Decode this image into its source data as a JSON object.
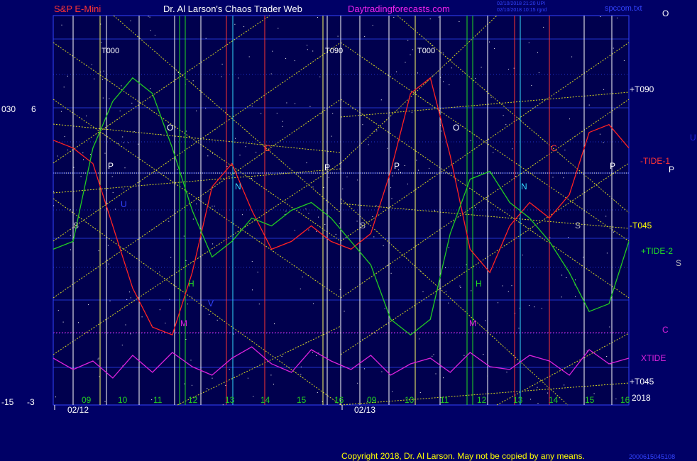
{
  "header": {
    "instrument": "S&P E-Mini",
    "title": "Dr. Al Larson's Chaos Trader Web",
    "site": "Daytradingforecasts.com",
    "stamp1": "02/10/2018 21:20 UPI",
    "stamp2": "02/10/2018 10:15 rgnd",
    "file": "spccom.txt",
    "corner_letter": "O"
  },
  "footer": {
    "copyright": "Copyright 2018, Dr. Al Larson. May not be copied by any means.",
    "code": "2000615045108"
  },
  "left_scale": {
    "row_top": [
      "030",
      "6"
    ],
    "row_bottom": [
      "-15",
      "-3"
    ]
  },
  "right_labels": [
    {
      "text": "+T090",
      "color": "#ffffff"
    },
    {
      "text": "-TIDE-1",
      "color": "#ff3333"
    },
    {
      "text": "P",
      "color": "#ffffff"
    },
    {
      "text": "U",
      "color": "#2222dd"
    },
    {
      "text": "-T045",
      "color": "#ffff00"
    },
    {
      "text": "+TIDE-2",
      "color": "#22dd22"
    },
    {
      "text": "S",
      "color": "#bbbbbb"
    },
    {
      "text": "C",
      "color": "#dd22dd"
    },
    {
      "text": "XTIDE",
      "color": "#dd22dd"
    },
    {
      "text": "+T045",
      "color": "#ffffff"
    },
    {
      "text": "2018",
      "color": "#ffffff"
    }
  ],
  "chart_data": {
    "type": "line",
    "x_axis": {
      "hour_labels": [
        "09",
        "10",
        "11",
        "12",
        "13",
        "14",
        "15",
        "16",
        "09",
        "10",
        "11",
        "12",
        "13",
        "14",
        "15",
        "16"
      ],
      "date_labels": [
        "02/12",
        "02/13"
      ]
    },
    "vertical_marker_labels": [
      "T000",
      "T090",
      "T000"
    ],
    "planet_letters": [
      "O",
      "P",
      "S",
      "N",
      "C",
      "U",
      "H",
      "M",
      "V",
      "P",
      "O",
      "P",
      "S",
      "C",
      "N",
      "H",
      "M",
      "S",
      "P"
    ],
    "series": [
      {
        "name": "-TIDE-1",
        "color": "#ff2222",
        "values": [
          0.68,
          0.66,
          0.62,
          0.46,
          0.3,
          0.2,
          0.18,
          0.34,
          0.56,
          0.62,
          0.5,
          0.4,
          0.42,
          0.46,
          0.42,
          0.4,
          0.44,
          0.6,
          0.8,
          0.84,
          0.64,
          0.4,
          0.34,
          0.46,
          0.52,
          0.48,
          0.54,
          0.7,
          0.72,
          0.66
        ]
      },
      {
        "name": "+TIDE-2",
        "color": "#22cc22",
        "values": [
          0.4,
          0.42,
          0.66,
          0.78,
          0.84,
          0.8,
          0.66,
          0.5,
          0.38,
          0.42,
          0.48,
          0.46,
          0.5,
          0.52,
          0.48,
          0.42,
          0.36,
          0.22,
          0.18,
          0.22,
          0.44,
          0.58,
          0.6,
          0.52,
          0.48,
          0.42,
          0.34,
          0.24,
          0.26,
          0.42
        ]
      },
      {
        "name": "XTIDE",
        "color": "#dd22dd",
        "values": [
          0.1,
          0.06,
          0.09,
          0.03,
          0.11,
          0.05,
          0.12,
          0.07,
          0.04,
          0.1,
          0.14,
          0.08,
          0.05,
          0.13,
          0.09,
          0.06,
          0.11,
          0.04,
          0.08,
          0.1,
          0.05,
          0.12,
          0.07,
          0.06,
          0.11,
          0.09,
          0.04,
          0.13,
          0.08,
          0.1
        ]
      }
    ],
    "grid": true,
    "legend": "right"
  }
}
